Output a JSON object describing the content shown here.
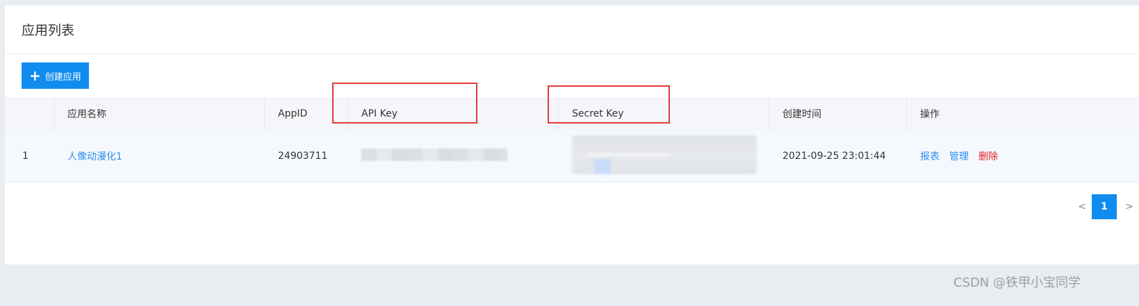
{
  "panel": {
    "title": "应用列表"
  },
  "toolbar": {
    "create_label": "创建应用"
  },
  "table": {
    "columns": {
      "index": "",
      "name": "应用名称",
      "appid": "AppID",
      "api_key": "API Key",
      "secret_key": "Secret Key",
      "created": "创建时间",
      "actions": "操作"
    },
    "rows": [
      {
        "index": "1",
        "name": "人像动漫化1",
        "appid": "24903711",
        "created": "2021-09-25 23:01:44",
        "actions": {
          "report": "报表",
          "manage": "管理",
          "delete": "删除"
        }
      }
    ]
  },
  "pagination": {
    "prev": "<",
    "current": "1",
    "next": ">"
  },
  "watermark": "CSDN @铁甲小宝同学",
  "colors": {
    "primary": "#108cee",
    "link": "#2d8cf0",
    "danger": "#e02020",
    "highlight_box": "#e53935"
  }
}
